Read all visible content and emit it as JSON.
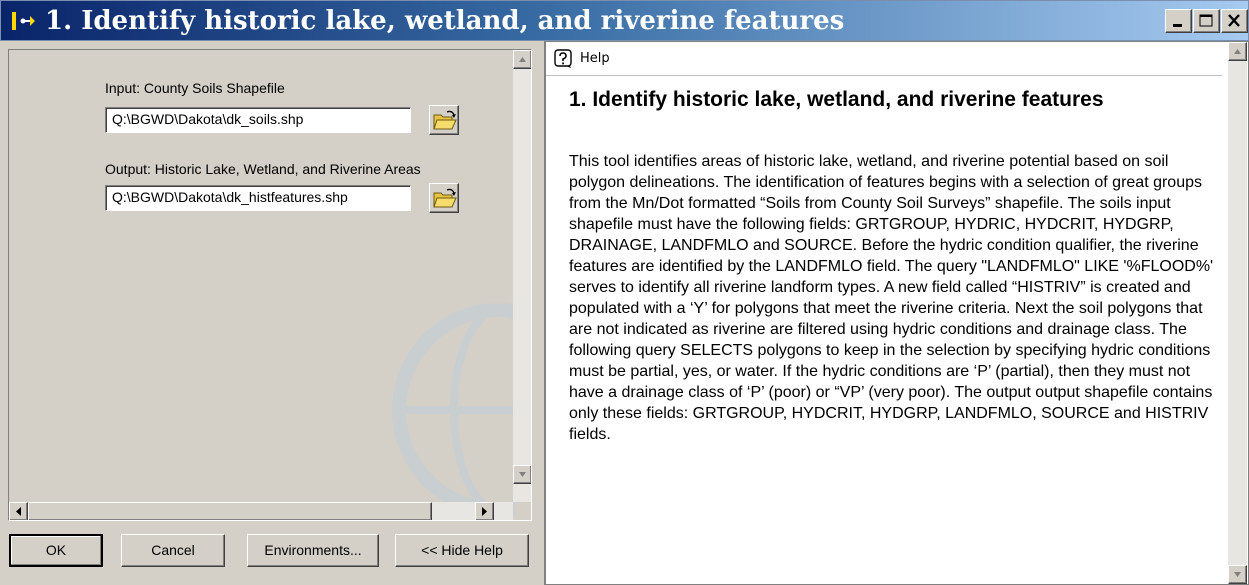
{
  "window": {
    "title": "1. Identify historic lake, wetland, and riverine features",
    "controls": {
      "minimize": "_",
      "maximize": "□",
      "close": "X"
    }
  },
  "form": {
    "input": {
      "label": "Input: County Soils Shapefile",
      "value": "Q:\\BGWD\\Dakota\\dk_soils.shp"
    },
    "output": {
      "label": "Output:  Historic Lake, Wetland, and Riverine Areas",
      "value": "Q:\\BGWD\\Dakota\\dk_histfeatures.shp"
    },
    "browse_icon": "open-folder-icon"
  },
  "buttons": {
    "ok": "OK",
    "cancel": "Cancel",
    "environments": "Environments...",
    "hide_help": "<< Hide Help"
  },
  "help": {
    "toolbar_label": "Help",
    "heading": "1. Identify historic lake, wetland, and riverine features",
    "body": "This tool identifies areas of historic lake, wetland, and riverine potential based on soil polygon delineations. The identification of features begins with a selection of great groups from the Mn/Dot formatted “Soils from County Soil Surveys” shapefile. The soils input shapefile must have the following fields: GRTGROUP, HYDRIC, HYDCRIT, HYDGRP, DRAINAGE, LANDFMLO and SOURCE. Before the hydric condition qualifier, the riverine features are identified by the LANDFMLO field. The query \"LANDFMLO\" LIKE '%FLOOD%' serves to identify all riverine landform types. A new field called “HISTRIV” is created and populated with a ‘Y’ for polygons that meet the riverine criteria. Next the soil polygons that are not indicated as riverine are filtered using hydric conditions and drainage class. The following query SELECTS polygons to keep in the selection by specifying hydric conditions must be partial, yes, or water. If the hydric conditions are ‘P’ (partial), then they must not have a drainage class of ‘P’ (poor) or “VP’ (very poor). The output output shapefile contains only these fields: GRTGROUP, HYDCRIT, HYDGRP, LANDFMLO, SOURCE and HISTRIV fields."
  },
  "colors": {
    "titlebar_start": "#0a246a",
    "titlebar_end": "#a6caf0",
    "panel_bg": "#d4d0c8"
  }
}
